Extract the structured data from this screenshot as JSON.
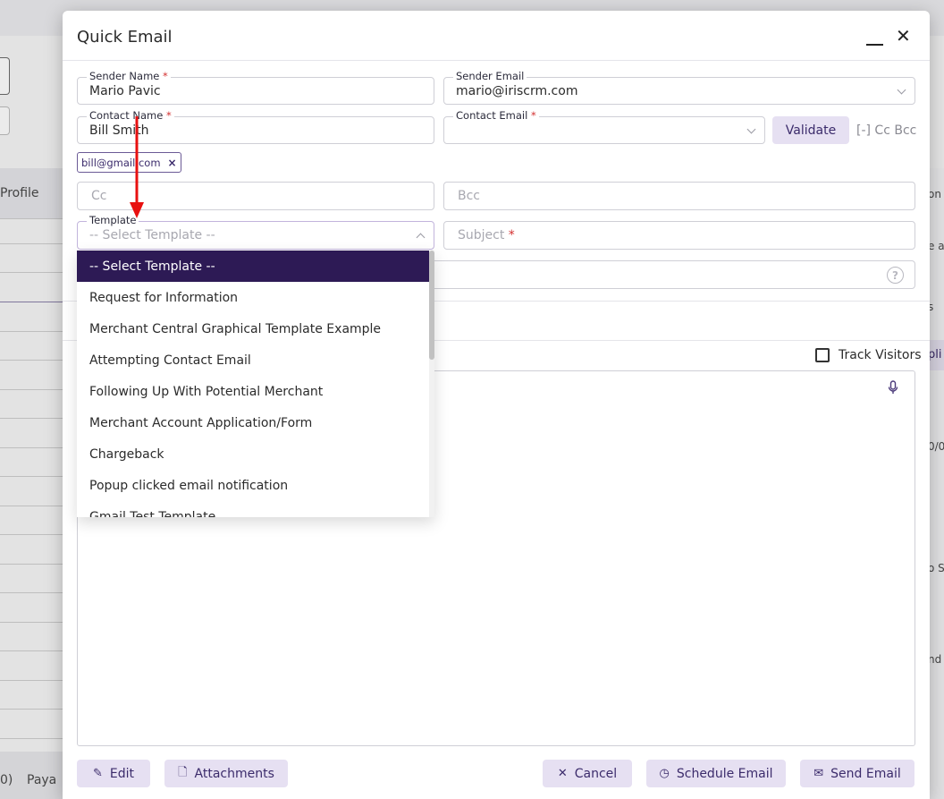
{
  "background": {
    "profile_label": "Profile",
    "footer_left": "0)",
    "footer_right": "Paya",
    "right_snippets": [
      "on (",
      "e a",
      "s",
      "pli",
      "0/0",
      "o Se",
      "nd"
    ]
  },
  "modal": {
    "title": "Quick Email",
    "sender_name": {
      "label": "Sender Name",
      "value": "Mario Pavic"
    },
    "sender_email": {
      "label": "Sender Email",
      "value": "mario@iriscrm.com"
    },
    "contact_name": {
      "label": "Contact Name",
      "value": "Bill Smith"
    },
    "contact_email": {
      "label": "Contact Email",
      "value": ""
    },
    "validate_label": "Validate",
    "cc_bcc_toggle": "[-] Cc Bcc",
    "chip": {
      "label": "bill@gmail.com",
      "remove": "×"
    },
    "cc": {
      "placeholder": "Cc"
    },
    "bcc": {
      "placeholder": "Bcc"
    },
    "template": {
      "label": "Template",
      "placeholder": "-- Select Template --"
    },
    "subject": {
      "placeholder": "Subject"
    },
    "track_visitors_label": "Track Visitors",
    "help_glyph": "?",
    "buttons": {
      "edit": "Edit",
      "attachments": "Attachments",
      "cancel": "Cancel",
      "schedule": "Schedule Email",
      "send": "Send Email"
    }
  },
  "template_options": [
    "-- Select Template --",
    "Request for Information",
    "Merchant Central Graphical Template Example",
    "Attempting Contact Email",
    "Following Up With Potential Merchant",
    "Merchant Account Application/Form",
    "Chargeback",
    "Popup clicked email notification",
    "Gmail Test Template"
  ],
  "colors": {
    "brand_dark": "#2d1a55",
    "brand_light": "#e6e0f2",
    "annotation_arrow": "#e81010"
  }
}
